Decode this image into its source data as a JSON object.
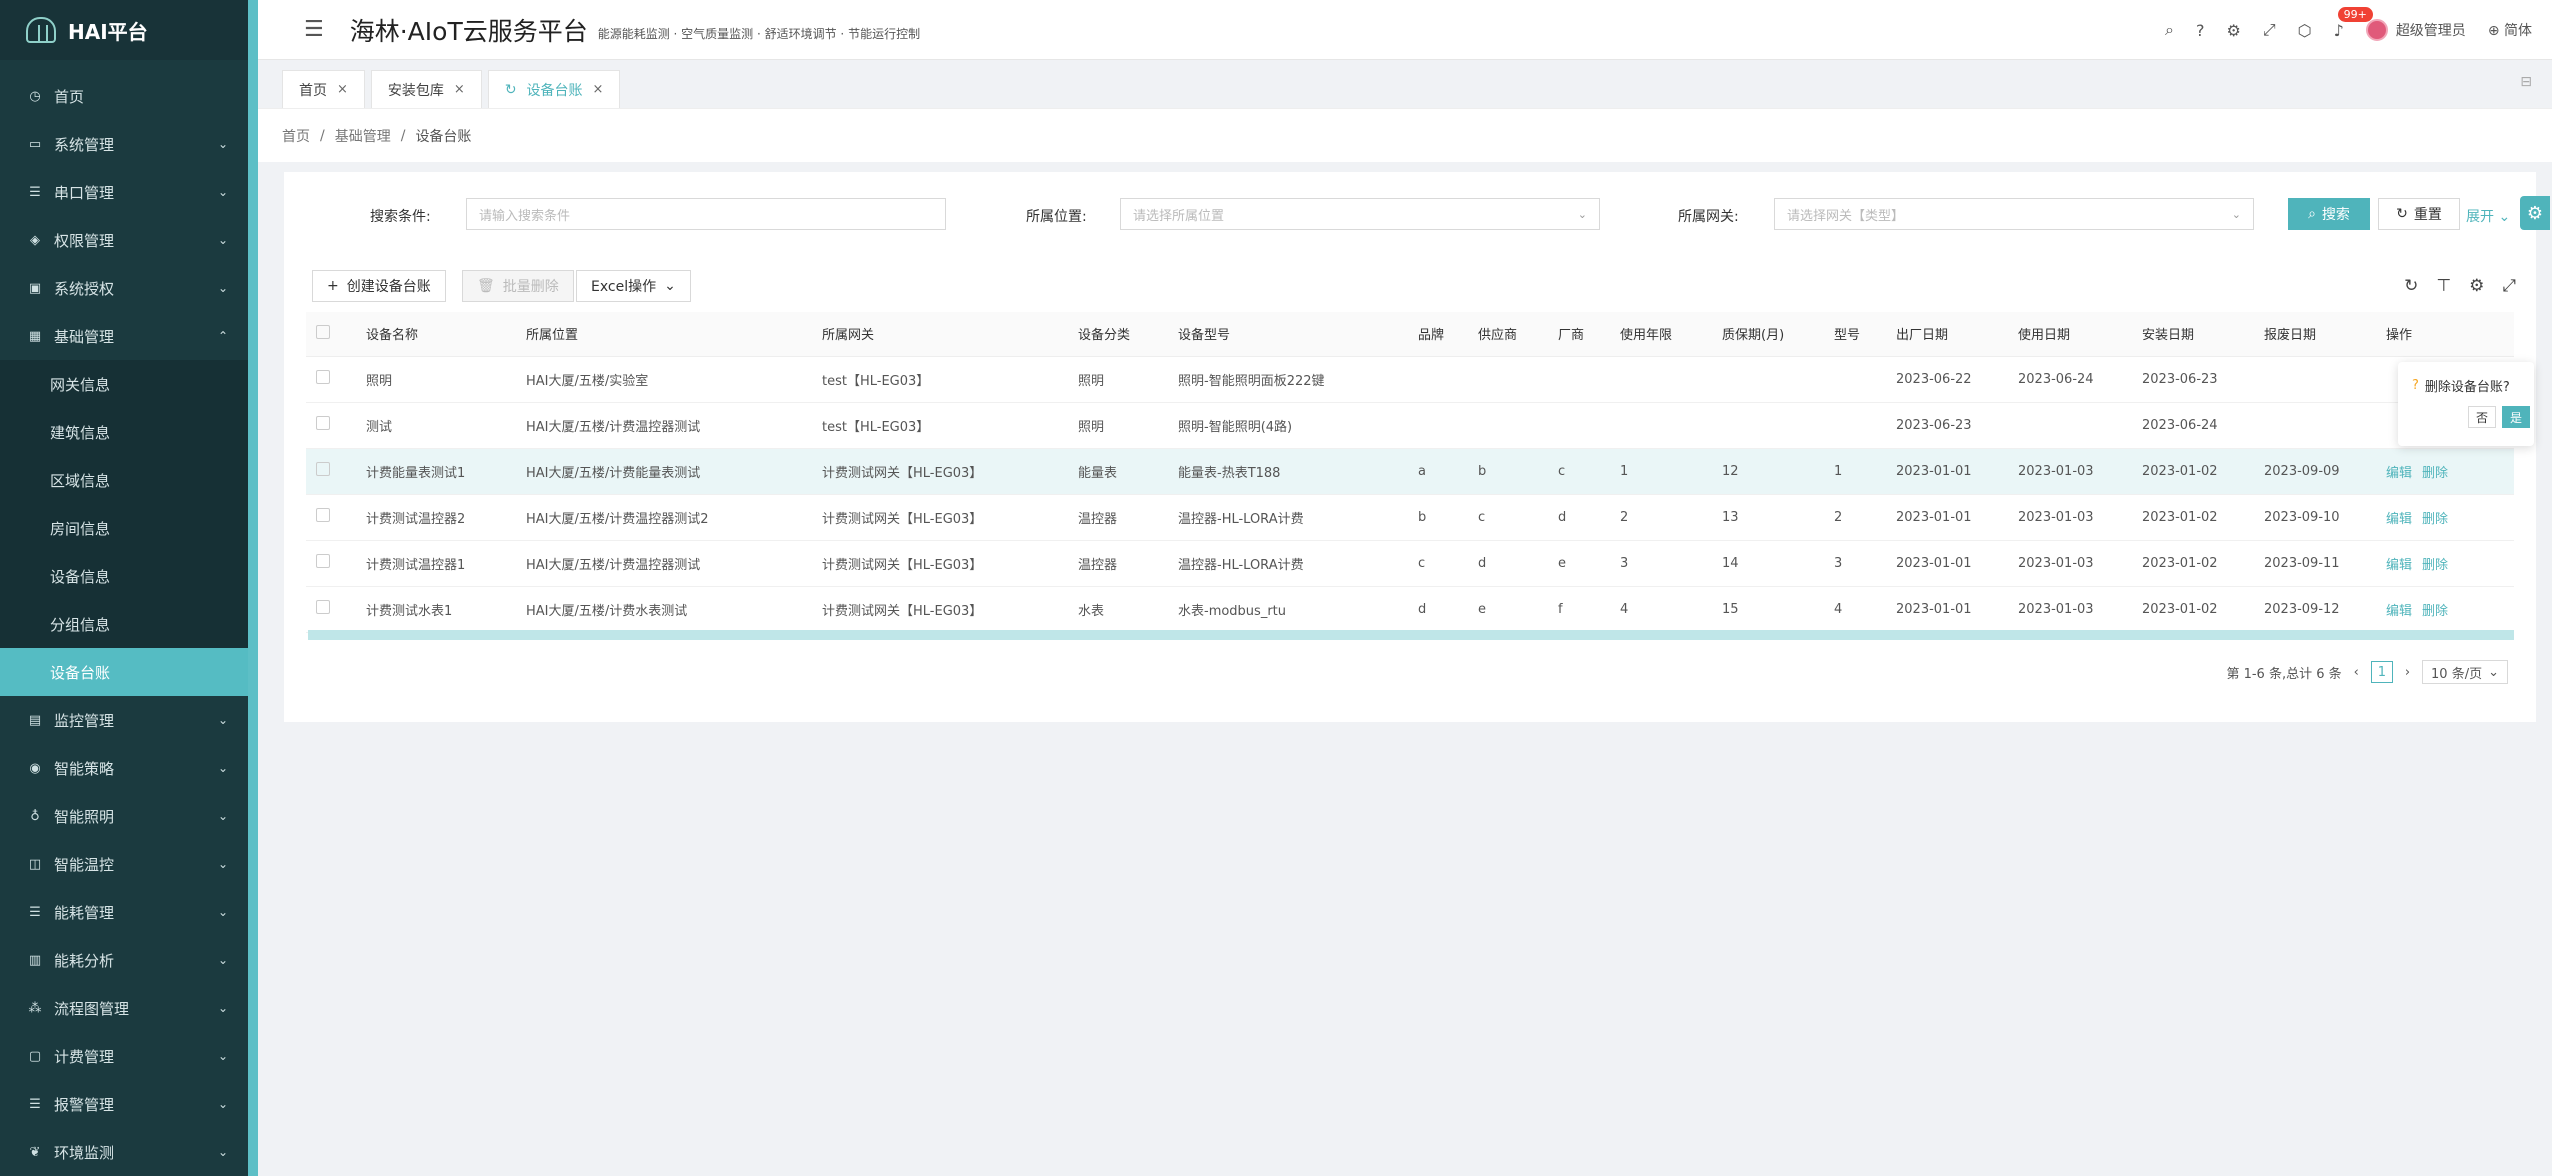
{
  "app": {
    "logo_text": "HAI平台",
    "title": "海林·AIoT云服务平台",
    "subtitle": "能源能耗监测 · 空气质量监测 · 舒适环境调节 · 节能运行控制",
    "notification_count": "99+",
    "user_name": "超级管理员",
    "language": "简体"
  },
  "sidebar": {
    "items": [
      {
        "label": "首页",
        "icon": "dashboard-icon"
      },
      {
        "label": "系统管理",
        "icon": "monitor-icon"
      },
      {
        "label": "串口管理",
        "icon": "sliders-icon"
      },
      {
        "label": "权限管理",
        "icon": "shield-icon"
      },
      {
        "label": "系统授权",
        "icon": "license-icon"
      },
      {
        "label": "基础管理",
        "icon": "grid-icon"
      },
      {
        "label": "网关信息"
      },
      {
        "label": "建筑信息"
      },
      {
        "label": "区域信息"
      },
      {
        "label": "房间信息"
      },
      {
        "label": "设备信息"
      },
      {
        "label": "分组信息"
      },
      {
        "label": "设备台账"
      },
      {
        "label": "监控管理",
        "icon": "monitor-icon"
      },
      {
        "label": "智能策略",
        "icon": "location-icon"
      },
      {
        "label": "智能照明",
        "icon": "bulb-icon"
      },
      {
        "label": "智能温控",
        "icon": "thermo-icon"
      },
      {
        "label": "能耗管理",
        "icon": "sliders-icon"
      },
      {
        "label": "能耗分析",
        "icon": "chart-icon"
      },
      {
        "label": "流程图管理",
        "icon": "flow-icon"
      },
      {
        "label": "计费管理",
        "icon": "bill-icon"
      },
      {
        "label": "报警管理",
        "icon": "alarm-icon"
      },
      {
        "label": "环境监测",
        "icon": "leaf-icon"
      }
    ]
  },
  "tabs": [
    {
      "label": "首页"
    },
    {
      "label": "安装包库"
    },
    {
      "label": "设备台账"
    }
  ],
  "breadcrumb": [
    "首页",
    "基础管理",
    "设备台账"
  ],
  "search": {
    "cond_label": "搜索条件:",
    "cond_placeholder": "请输入搜索条件",
    "location_label": "所属位置:",
    "location_placeholder": "请选择所属位置",
    "gateway_label": "所属网关:",
    "gateway_placeholder": "请选择网关【类型】",
    "search_btn": "搜索",
    "reset_btn": "重置",
    "expand_btn": "展开"
  },
  "toolbar": {
    "create_btn": "创建设备台账",
    "batch_delete_btn": "批量删除",
    "excel_btn": "Excel操作"
  },
  "table": {
    "headers": [
      "设备名称",
      "所属位置",
      "所属网关",
      "设备分类",
      "设备型号",
      "品牌",
      "供应商",
      "厂商",
      "使用年限",
      "质保期(月)",
      "型号",
      "出厂日期",
      "使用日期",
      "安装日期",
      "报废日期",
      "操作"
    ],
    "rows": [
      [
        "照明",
        "HAI大厦/五楼/实验室",
        "test【HL-EG03】",
        "照明",
        "照明-智能照明面板222键",
        "",
        "",
        "",
        "",
        "",
        "",
        "2023-06-22",
        "2023-06-24",
        "2023-06-23",
        ""
      ],
      [
        "测试",
        "HAI大厦/五楼/计费温控器测试",
        "test【HL-EG03】",
        "照明",
        "照明-智能照明(4路)",
        "",
        "",
        "",
        "",
        "",
        "",
        "2023-06-23",
        "",
        "2023-06-24",
        ""
      ],
      [
        "计费能量表测试1",
        "HAI大厦/五楼/计费能量表测试",
        "计费测试网关【HL-EG03】",
        "能量表",
        "能量表-热表T188",
        "a",
        "b",
        "c",
        "1",
        "12",
        "1",
        "2023-01-01",
        "2023-01-03",
        "2023-01-02",
        "2023-09-09"
      ],
      [
        "计费测试温控器2",
        "HAI大厦/五楼/计费温控器测试2",
        "计费测试网关【HL-EG03】",
        "温控器",
        "温控器-HL-LORA计费",
        "b",
        "c",
        "d",
        "2",
        "13",
        "2",
        "2023-01-01",
        "2023-01-03",
        "2023-01-02",
        "2023-09-10"
      ],
      [
        "计费测试温控器1",
        "HAI大厦/五楼/计费温控器测试",
        "计费测试网关【HL-EG03】",
        "温控器",
        "温控器-HL-LORA计费",
        "c",
        "d",
        "e",
        "3",
        "14",
        "3",
        "2023-01-01",
        "2023-01-03",
        "2023-01-02",
        "2023-09-11"
      ],
      [
        "计费测试水表1",
        "HAI大厦/五楼/计费水表测试",
        "计费测试网关【HL-EG03】",
        "水表",
        "水表-modbus_rtu",
        "d",
        "e",
        "f",
        "4",
        "15",
        "4",
        "2023-01-01",
        "2023-01-03",
        "2023-01-02",
        "2023-09-12"
      ]
    ],
    "edit_label": "编辑",
    "delete_label": "删除"
  },
  "popconfirm": {
    "message": "删除设备台账?",
    "no": "否",
    "yes": "是"
  },
  "pagination": {
    "summary": "第 1-6 条,总计 6 条",
    "current": "1",
    "page_size": "10 条/页"
  },
  "colors": {
    "accent": "#4fb4bb",
    "sidebar_bg": "#1b3a3f"
  }
}
